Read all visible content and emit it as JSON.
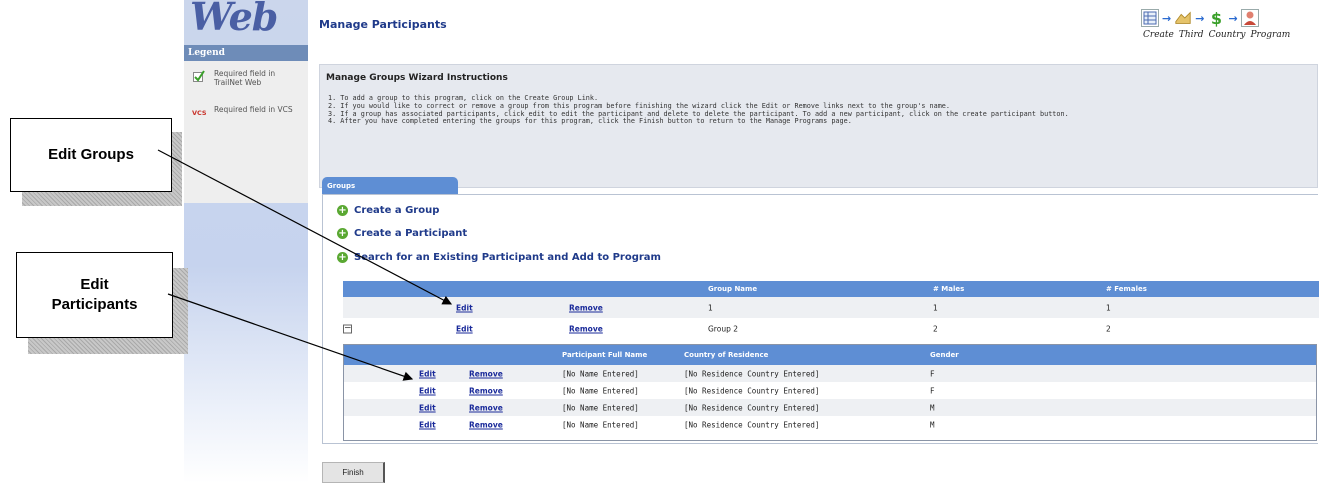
{
  "callouts": {
    "edit_groups": "Edit Groups",
    "edit_participants": "Edit Participants"
  },
  "sidebar": {
    "logo": "Web",
    "legend_title": "Legend",
    "legend_items": [
      {
        "icon": "green-check-icon",
        "text": "Required field in TrailNet Web"
      },
      {
        "icon": "vcs-icon",
        "text": "Required field in VCS"
      }
    ]
  },
  "header": {
    "title": "Manage Participants",
    "wizard_steps": [
      "Create",
      "Third",
      "Country",
      "Program"
    ]
  },
  "instructions": {
    "title": "Manage Groups Wizard Instructions",
    "items": [
      "1.  To add a group to this program, click on the Create Group Link.",
      "2.  If you would like to correct or remove a group from this program before finishing the wizard click the Edit or Remove links next to the group's name.",
      "3.  If a group has associated participants, click edit to edit the participant and delete to delete the participant. To add a new participant, click on the create participant button.",
      "4.  After you have completed entering the groups for this program, click the Finish button to return to the Manage Programs page."
    ]
  },
  "groups": {
    "tab_label": "Groups",
    "actions": [
      "Create a Group",
      "Create a Participant",
      "Search for an Existing Participant and Add to Program"
    ],
    "columns": [
      "Group Name",
      "# Males",
      "# Females"
    ],
    "edit_label": "Edit",
    "remove_label": "Remove",
    "rows": [
      {
        "name": "1",
        "males": "1",
        "females": "1"
      },
      {
        "name": "Group 2",
        "males": "2",
        "females": "2"
      }
    ]
  },
  "participants": {
    "columns": [
      "Participant Full Name",
      "Country of Residence",
      "Gender"
    ],
    "rows": [
      {
        "name": "[No Name Entered]",
        "country": "[No Residence Country Entered]",
        "gender": "F"
      },
      {
        "name": "[No Name Entered]",
        "country": "[No Residence Country Entered]",
        "gender": "F"
      },
      {
        "name": "[No Name Entered]",
        "country": "[No Residence Country Entered]",
        "gender": "M"
      },
      {
        "name": "[No Name Entered]",
        "country": "[No Residence Country Entered]",
        "gender": "M"
      }
    ]
  },
  "footer": {
    "finish_label": "Finish"
  },
  "colors": {
    "header_blue": "#5e8ed4",
    "link_blue": "#1a2a9a",
    "title_blue": "#1f3a8a"
  }
}
